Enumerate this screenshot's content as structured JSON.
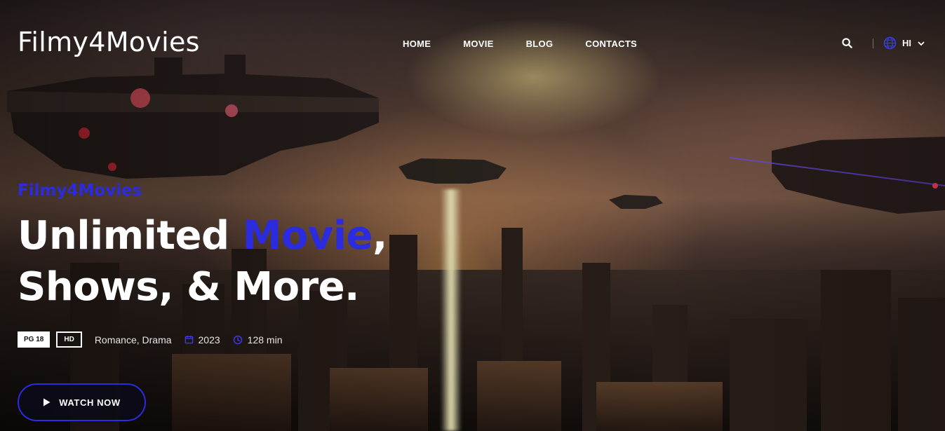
{
  "header": {
    "logo": "Filmy4Movies",
    "nav": [
      {
        "label": "HOME"
      },
      {
        "label": "MOVIE"
      },
      {
        "label": "BLOG"
      },
      {
        "label": "CONTACTS"
      }
    ],
    "search_icon": "search-icon",
    "language": {
      "icon": "globe-icon",
      "value": "HI",
      "caret": "chevron-down-icon"
    }
  },
  "hero": {
    "subtitle": "Filmy4Movies",
    "headline_part1": "Unlimited ",
    "headline_accent": "Movie",
    "headline_part2": ",",
    "headline_line2": "Shows, & More.",
    "badges": {
      "rating": "PG 18",
      "quality": "HD"
    },
    "genres": "Romance, Drama",
    "year": "2023",
    "duration": "128 min",
    "cta_label": "WATCH NOW"
  },
  "colors": {
    "accent": "#2b2bdf",
    "background": "#1a1210"
  }
}
